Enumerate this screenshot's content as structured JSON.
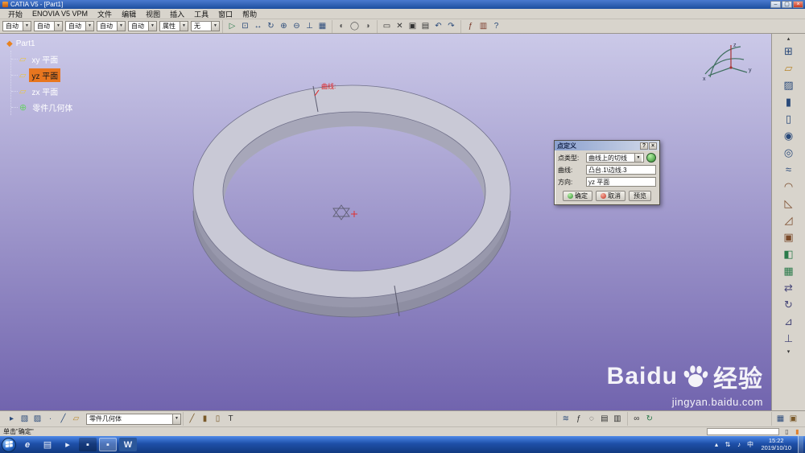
{
  "ui": {
    "dropdown_arrow": "▼",
    "tray_expand": "▴"
  },
  "window": {
    "title": "CATIA V5 - [Part1]",
    "min_label": "–",
    "max_label": "▢",
    "close_label": "×"
  },
  "menubar": {
    "items": [
      "开始",
      "ENOVIA V5 VPM",
      "文件",
      "编辑",
      "视图",
      "插入",
      "工具",
      "窗口",
      "帮助"
    ]
  },
  "toolbar": {
    "combos": [
      {
        "name": "graphic-color-combo",
        "value": "自动"
      },
      {
        "name": "graphic-linetype-combo",
        "value": "自动"
      },
      {
        "name": "graphic-thickness-combo",
        "value": "自动"
      },
      {
        "name": "graphic-point-combo",
        "value": "自动"
      },
      {
        "name": "graphic-layer-combo",
        "value": "自动"
      },
      {
        "name": "graphic-render-combo",
        "value": "属性"
      },
      {
        "name": "line-weight-combo",
        "value": "无"
      }
    ],
    "groups": [
      {
        "icons": [
          {
            "name": "fly-mode-icon",
            "glyph": "▷",
            "color": "#2a7a4a"
          },
          {
            "name": "fit-all-icon",
            "glyph": "⊡",
            "color": "#2a4a7a"
          },
          {
            "name": "pan-icon",
            "glyph": "↔",
            "color": "#2a4a7a"
          },
          {
            "name": "rotate-view-icon",
            "glyph": "↻",
            "color": "#2a4a7a"
          },
          {
            "name": "zoom-in-icon",
            "glyph": "⊕",
            "color": "#2a4a7a"
          },
          {
            "name": "zoom-out-icon",
            "glyph": "⊖",
            "color": "#2a4a7a"
          },
          {
            "name": "normal-view-icon",
            "glyph": "⊥",
            "color": "#2a4a7a"
          },
          {
            "name": "multi-view-icon",
            "glyph": "▦",
            "color": "#2a4a7a"
          }
        ]
      },
      {
        "icons": [
          {
            "name": "shaded-view-icon",
            "glyph": "◐",
            "color": "#555555"
          },
          {
            "name": "wireframe-view-icon",
            "glyph": "◯",
            "color": "#555555"
          },
          {
            "name": "hide-show-icon",
            "glyph": "◑",
            "color": "#555555"
          }
        ]
      },
      {
        "icons": [
          {
            "name": "print-icon",
            "glyph": "▭",
            "color": "#333333"
          },
          {
            "name": "cut-icon",
            "glyph": "✕",
            "color": "#333333"
          },
          {
            "name": "copy-icon",
            "glyph": "▣",
            "color": "#333333"
          },
          {
            "name": "paste-icon",
            "glyph": "▤",
            "color": "#333333"
          },
          {
            "name": "undo-icon",
            "glyph": "↶",
            "color": "#2a4a7a"
          },
          {
            "name": "redo-icon",
            "glyph": "↷",
            "color": "#2a4a7a"
          }
        ]
      },
      {
        "icons": [
          {
            "name": "knowledge-fx-icon",
            "glyph": "ƒ",
            "color": "#7a3a2a"
          },
          {
            "name": "catalog-icon",
            "glyph": "▥",
            "color": "#7a3a2a"
          },
          {
            "name": "help-whats-this-icon",
            "glyph": "?",
            "color": "#2a4a7a"
          }
        ]
      }
    ]
  },
  "tree": {
    "root": "Part1",
    "items": [
      {
        "label": "xy 平面",
        "selected": false,
        "icon": "plane-icon",
        "glyph": "▱"
      },
      {
        "label": "yz 平面",
        "selected": true,
        "icon": "plane-icon",
        "glyph": "▱"
      },
      {
        "label": "zx 平面",
        "selected": false,
        "icon": "plane-icon",
        "glyph": "▱"
      },
      {
        "label": "零件几何体",
        "selected": false,
        "icon": "part-body-icon",
        "glyph": "⊕"
      }
    ]
  },
  "viewport": {
    "annotation": "曲线:",
    "compass": {
      "z": "z",
      "y": "y",
      "x": "x"
    }
  },
  "dialog": {
    "title": "点定义",
    "help": "?",
    "close": "×",
    "rows": [
      {
        "label": "点类型:",
        "value": "曲线上的切线"
      },
      {
        "label": "曲线:",
        "value": "凸台.1\\边线.3"
      },
      {
        "label": "方向:",
        "value": "yz 平面"
      }
    ],
    "ok": "确定",
    "cancel": "取消",
    "preview": "预览"
  },
  "right_toolbar": {
    "icons": [
      {
        "name": "scroll-up-icon",
        "glyph": "▴",
        "color": "#333333",
        "cls": "small"
      },
      {
        "name": "reframe-icon",
        "glyph": "⊞",
        "color": "#2a4a7a"
      },
      {
        "name": "plane-feature-icon",
        "glyph": "▱",
        "color": "#b8862a"
      },
      {
        "name": "sketcher-icon",
        "glyph": "▨",
        "color": "#2a4a7a"
      },
      {
        "name": "pad-icon",
        "glyph": "▮",
        "color": "#2a4a7a"
      },
      {
        "name": "pocket-icon",
        "glyph": "▯",
        "color": "#2a4a7a"
      },
      {
        "name": "shaft-icon",
        "glyph": "◉",
        "color": "#2a4a7a"
      },
      {
        "name": "hole-icon",
        "glyph": "◎",
        "color": "#2a4a7a"
      },
      {
        "name": "rib-icon",
        "glyph": "≈",
        "color": "#2a4a7a"
      },
      {
        "name": "fillet-icon",
        "glyph": "◠",
        "color": "#7a4a2a"
      },
      {
        "name": "chamfer-icon",
        "glyph": "◺",
        "color": "#7a4a2a"
      },
      {
        "name": "draft-icon",
        "glyph": "◿",
        "color": "#7a4a2a"
      },
      {
        "name": "shell-icon",
        "glyph": "▣",
        "color": "#7a4a2a"
      },
      {
        "name": "mirror-icon",
        "glyph": "◧",
        "color": "#2a7a4a"
      },
      {
        "name": "pattern-icon",
        "glyph": "▦",
        "color": "#2a7a4a"
      },
      {
        "name": "translate-icon",
        "glyph": "⇄",
        "color": "#4a4a7a"
      },
      {
        "name": "rotate-body-icon",
        "glyph": "↻",
        "color": "#4a4a7a"
      },
      {
        "name": "measure-icon",
        "glyph": "⊿",
        "color": "#4a4a7a"
      },
      {
        "name": "axis-system-icon",
        "glyph": "⊥",
        "color": "#4a4a7a"
      },
      {
        "name": "scroll-down-icon",
        "glyph": "▾",
        "color": "#333333",
        "cls": "small"
      }
    ]
  },
  "bottom_toolbar": {
    "combo_value": "零件几何体",
    "left_icons": [
      {
        "name": "select-arrow-icon",
        "glyph": "▸",
        "color": "#2a4a7a"
      },
      {
        "name": "view-cube-icon",
        "glyph": "▧",
        "color": "#2a4a7a"
      },
      {
        "name": "sketch-grid-icon",
        "glyph": "▨",
        "color": "#2a4a7a"
      },
      {
        "name": "point-tool-icon",
        "glyph": "∙",
        "color": "#2a4a7a"
      },
      {
        "name": "line-tool-icon",
        "glyph": "╱",
        "color": "#2a4a7a"
      },
      {
        "name": "plane-tool-icon",
        "glyph": "▱",
        "color": "#b8862a"
      }
    ],
    "tools_icons": [
      {
        "name": "pencil-icon",
        "glyph": "╱",
        "color": "#7a5a2a"
      },
      {
        "name": "brush-icon",
        "glyph": "▮",
        "color": "#7a5a2a"
      },
      {
        "name": "eraser-icon",
        "glyph": "▯",
        "color": "#7a5a2a"
      },
      {
        "name": "text-tool-icon",
        "glyph": "T",
        "color": "#333333"
      }
    ],
    "analysis_icons": [
      {
        "name": "fog-icon",
        "glyph": "≋",
        "color": "#2a4a7a"
      },
      {
        "name": "fx-icon",
        "glyph": "ƒ",
        "color": "#333333"
      },
      {
        "name": "magnifier-icon",
        "glyph": "◌",
        "color": "#333333"
      },
      {
        "name": "layers-icon",
        "glyph": "▤",
        "color": "#333333"
      },
      {
        "name": "chart-icon",
        "glyph": "▥",
        "color": "#333333"
      }
    ],
    "link_icons": [
      {
        "name": "link-icon",
        "glyph": "∞",
        "color": "#333333"
      },
      {
        "name": "update-icon",
        "glyph": "↻",
        "color": "#2a7a4a"
      }
    ],
    "right_icons": [
      {
        "name": "snap-grid-icon",
        "glyph": "▦",
        "color": "#2a4a7a"
      },
      {
        "name": "lock-icon",
        "glyph": "▣",
        "color": "#7a5a2a"
      }
    ]
  },
  "statusbar": {
    "message": "单击\"确定\"",
    "icons": [
      {
        "name": "status-doc-icon",
        "glyph": "▯",
        "color": "#444444"
      },
      {
        "name": "status-box-icon",
        "glyph": "▮",
        "color": "#e0812e"
      }
    ]
  },
  "watermark": {
    "brand_latin": "Baidu",
    "brand_cjk": "经验",
    "url": "jingyan.baidu.com"
  },
  "taskbar": {
    "apps": [
      {
        "name": "ie-icon",
        "glyph": "e",
        "cls": "tb-ie"
      },
      {
        "name": "explorer-icon",
        "glyph": "▤",
        "cls": "tb-folder"
      },
      {
        "name": "media-player-icon",
        "glyph": "▸",
        "cls": "tb-media"
      },
      {
        "name": "app-window-icon-1",
        "glyph": "▪",
        "cls": "tb-dark"
      },
      {
        "name": "app-window-icon-2",
        "glyph": "▪",
        "cls": "tb-dark active"
      },
      {
        "name": "word-icon",
        "glyph": "W",
        "cls": "tb-word"
      }
    ],
    "tray": [
      {
        "name": "tray-expand-icon",
        "glyph": "▴"
      },
      {
        "name": "network-icon",
        "glyph": "⇅"
      },
      {
        "name": "volume-icon",
        "glyph": "♪"
      },
      {
        "name": "language-indicator",
        "glyph": "中"
      }
    ],
    "time": "15:22",
    "date": "2019/10/10"
  }
}
